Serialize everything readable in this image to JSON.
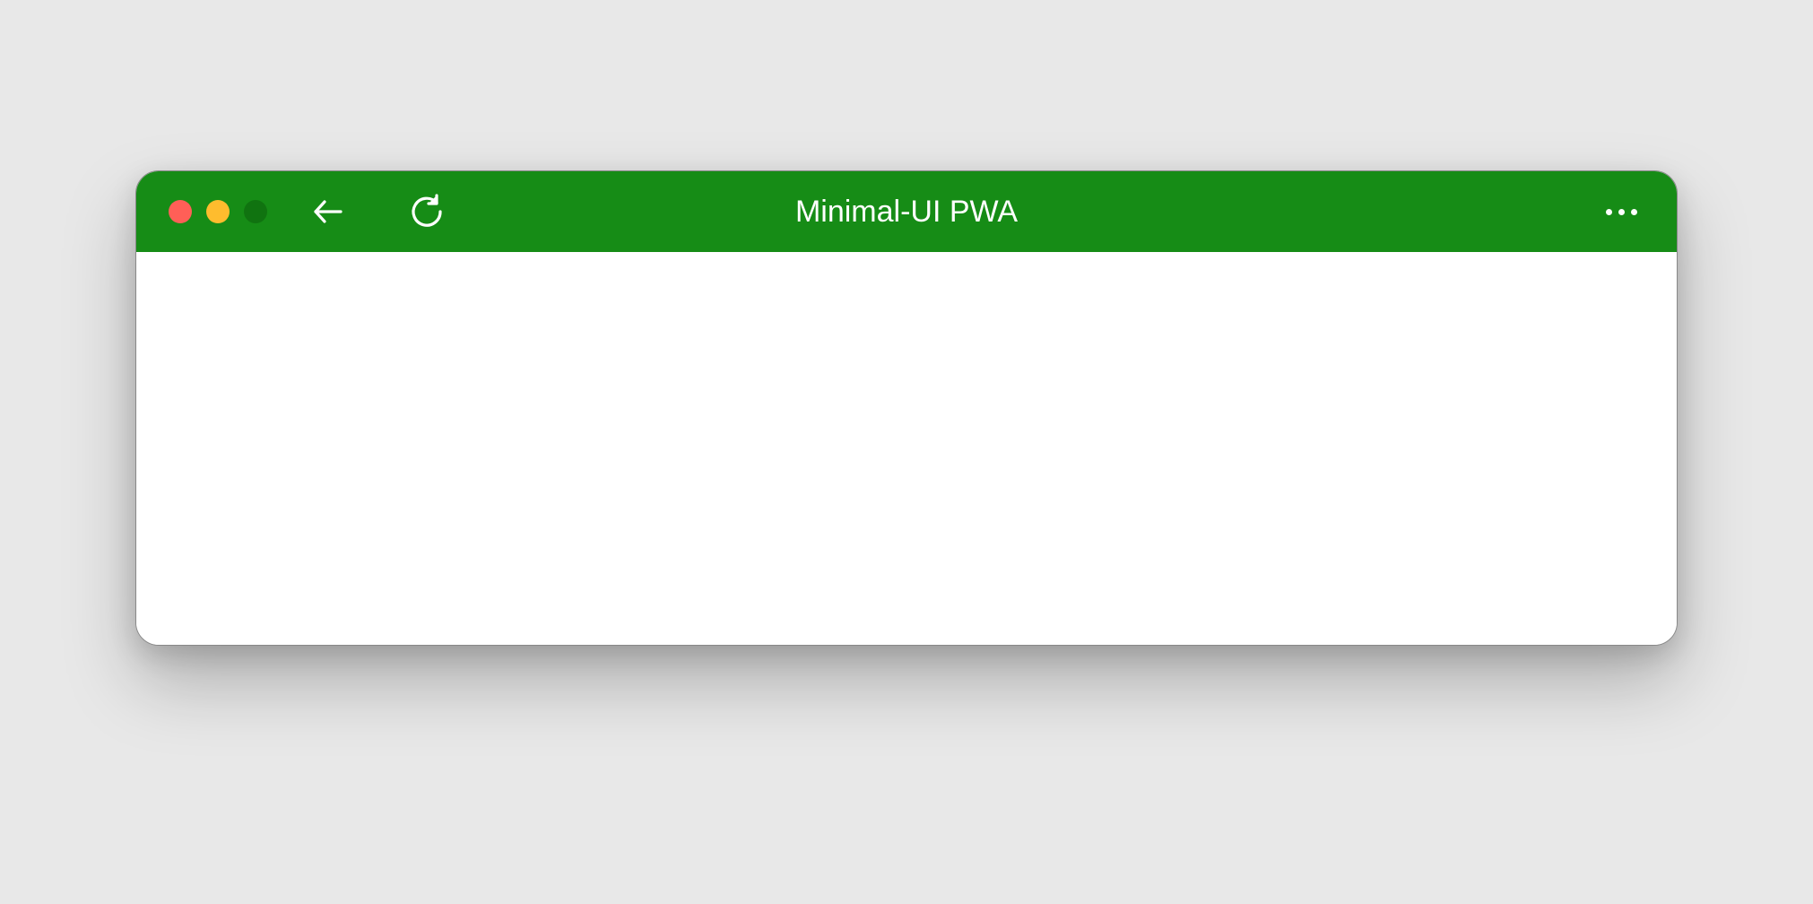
{
  "window": {
    "title": "Minimal-UI PWA"
  },
  "colors": {
    "titlebar_bg": "#168c16",
    "window_bg": "#ffffff",
    "page_bg": "#e8e8e8",
    "close": "#ff5f57",
    "minimize": "#febc2e",
    "maximize_dim": "#0f6e0f"
  },
  "icons": {
    "back": "arrow-left-icon",
    "reload": "reload-icon",
    "more": "more-icon"
  }
}
